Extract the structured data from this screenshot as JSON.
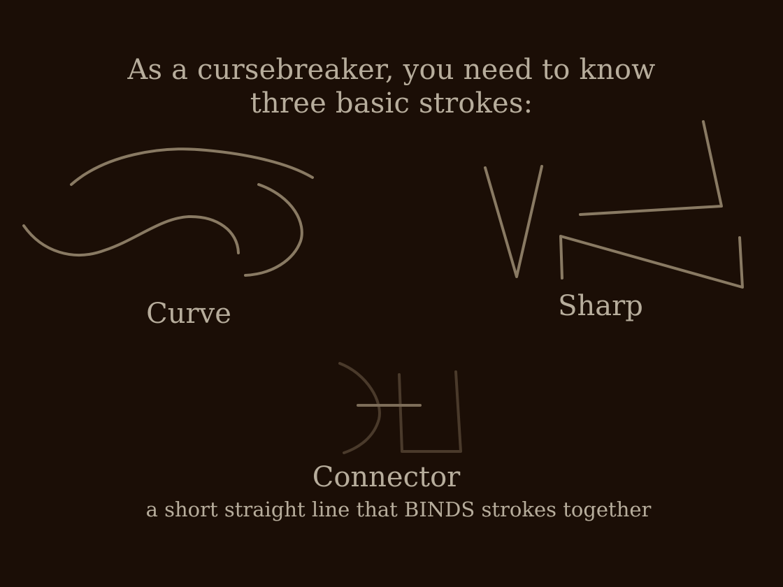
{
  "tutorial": {
    "heading_line1": "As a cursebreaker, you need to know",
    "heading_line2": "three basic strokes:",
    "strokes": [
      {
        "label": "Curve"
      },
      {
        "label": "Sharp"
      },
      {
        "label": "Connector",
        "description": "a short straight line that BINDS strokes together"
      }
    ]
  },
  "colors": {
    "background": "#1b0e06",
    "text": "#b7ad9c",
    "stroke": "#897a63",
    "stroke_dim": "#4a3a2b"
  }
}
